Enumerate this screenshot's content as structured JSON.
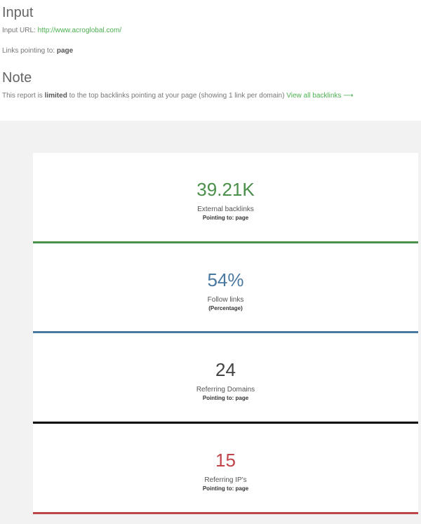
{
  "input": {
    "title": "Input",
    "url_label": "Input URL:",
    "url_value": "http://www.acroglobal.com/",
    "links_label": "Links pointing to:",
    "links_value": "page"
  },
  "note": {
    "title": "Note",
    "text_before": "This report is",
    "text_bold": "limited",
    "text_after": "to the top backlinks pointing at your page (showing 1 link per domain)",
    "link_text": "View all backlinks ⟶"
  },
  "stats": [
    {
      "value": "39.21K",
      "label": "External backlinks",
      "sub": "Pointing to: page",
      "color": "#4a8f4a"
    },
    {
      "value": "54%",
      "label": "Follow links",
      "sub": "(Percentage)",
      "color": "#4a78a0"
    },
    {
      "value": "24",
      "label": "Referring Domains",
      "sub": "Pointing to: page",
      "color": "#000000"
    },
    {
      "value": "15",
      "label": "Referring IP's",
      "sub": "Pointing to: page",
      "color": "#c0454a"
    }
  ]
}
